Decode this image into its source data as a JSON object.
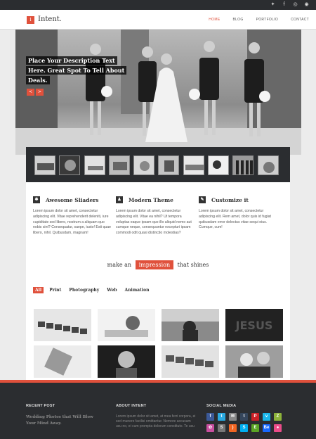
{
  "topbar": {
    "icons": [
      "twitter-icon",
      "facebook-icon",
      "dribbble-icon",
      "rss-icon"
    ]
  },
  "header": {
    "logo_glyph": "i",
    "logo_text": "Intent.",
    "nav": [
      "HOME",
      "BLOG",
      "PORTFOLIO",
      "CONTACT"
    ]
  },
  "hero": {
    "caption": "Place Your Description Text Here. Great Spot To Tell About Deals.",
    "prev": "<",
    "next": ">"
  },
  "features": [
    {
      "icon": "gear-icon",
      "glyph": "✱",
      "title": "Awesome Sliaders",
      "text": "Lorem ipsum dolor sit amet, consectetur adipiscing elit. Vitae reprehenderit deleniti, iure cupiditate sed libero, nostrum a aliquam quo nobis sint? Consequatur, saepe, iusto! Esti quae libero, nihil. Quibusdam, magnam!"
    },
    {
      "icon": "user-icon",
      "glyph": "♟",
      "title": "Modern Theme",
      "text": "Lorem ipsum dolor sit amet, consectetur adipiscing elit. Vitae ea nihil? Ut tempora voluptas eaque ipsam quo illo aliquid nemo aut cumque neque, consequuntur excepturi ipsam commodi odit quasi distinctio molestias?"
    },
    {
      "icon": "pencil-icon",
      "glyph": "✎",
      "title": "Customize it",
      "text": "Lorem ipsum dolor sit amet, consectetur adipiscing elit. Rem amet, dolor quis id fugiat quibusdam error delectus vitae sequi eius. Cumque, cum!"
    }
  ],
  "tagline": {
    "before": "make an",
    "highlight": "impression",
    "after": "that shines"
  },
  "filters": [
    "All",
    "Print",
    "Photography",
    "Web",
    "Animation"
  ],
  "footer": {
    "recent": {
      "heading": "RECENT POST",
      "post_title": "Wedding Photos that Will Blow Your Mind Away."
    },
    "about": {
      "heading": "ABOUT INTENT",
      "text": "Lorem ipsum dolor sit amet, at mea ferri corpora, ei sed munere facilisi omittantur. Nemore accusam usu no, ei cum prompta dolorum constituto. Te usu"
    },
    "social": {
      "heading": "SOCIAL MEDIA",
      "icons": [
        {
          "name": "facebook-icon",
          "glyph": "f",
          "color": "#3b5998"
        },
        {
          "name": "twitter-icon",
          "glyph": "t",
          "color": "#2aa9e0"
        },
        {
          "name": "email-icon",
          "glyph": "✉",
          "color": "#888888"
        },
        {
          "name": "tumblr-icon",
          "glyph": "t",
          "color": "#35465c"
        },
        {
          "name": "pinterest-icon",
          "glyph": "P",
          "color": "#cb2027"
        },
        {
          "name": "vimeo-icon",
          "glyph": "v",
          "color": "#1ab7ea"
        },
        {
          "name": "zerply-icon",
          "glyph": "Z",
          "color": "#8db33a"
        },
        {
          "name": "picasa-icon",
          "glyph": "✿",
          "color": "#c94fa0"
        },
        {
          "name": "stumbleupon-icon",
          "glyph": "S",
          "color": "#777777"
        },
        {
          "name": "rss-icon",
          "glyph": ")",
          "color": "#f26522"
        },
        {
          "name": "skype-icon",
          "glyph": "S",
          "color": "#00aff0"
        },
        {
          "name": "evernote-icon",
          "glyph": "E",
          "color": "#5ba525"
        },
        {
          "name": "behance-icon",
          "glyph": "Be",
          "color": "#1769ff"
        },
        {
          "name": "dribbble-icon",
          "glyph": "●",
          "color": "#ea4c89"
        }
      ]
    }
  },
  "colors": {
    "accent": "#e0513c",
    "dark": "#2b2d30"
  }
}
